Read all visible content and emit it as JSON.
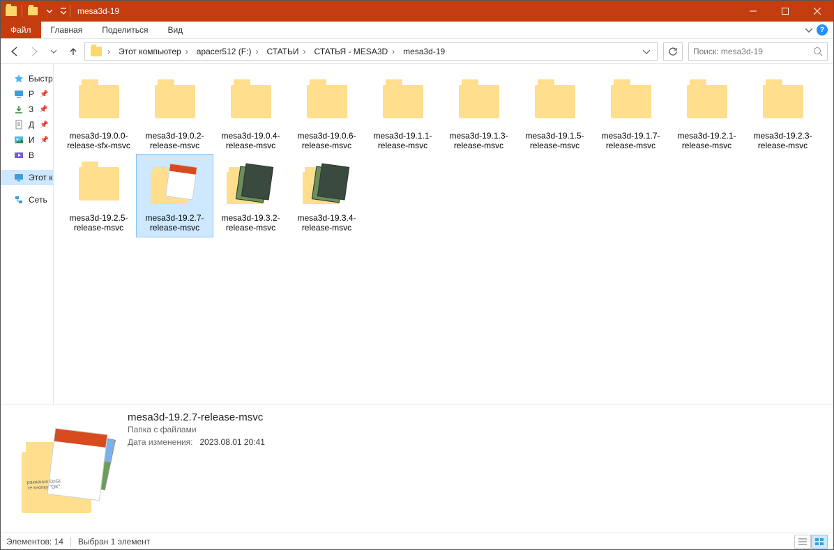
{
  "window": {
    "title": "mesa3d-19"
  },
  "tabs": {
    "file": "Файл",
    "home": "Главная",
    "share": "Поделиться",
    "view": "Вид"
  },
  "breadcrumbs": [
    "Этот компьютер",
    "apacer512 (F:)",
    "СТАТЬИ",
    "СТАТЬЯ - MESA3D",
    "mesa3d-19"
  ],
  "search": {
    "placeholder": "Поиск: mesa3d-19"
  },
  "sidebar": {
    "quick": "Быстр",
    "items": [
      {
        "label": "Р",
        "pinned": true,
        "icon": "desktop"
      },
      {
        "label": "З",
        "pinned": true,
        "icon": "downloads"
      },
      {
        "label": "Д",
        "pinned": true,
        "icon": "documents"
      },
      {
        "label": "И",
        "pinned": true,
        "icon": "pictures"
      },
      {
        "label": "В",
        "pinned": false,
        "icon": "videos"
      }
    ],
    "thispc": "Этот к",
    "network": "Сеть"
  },
  "folders": [
    {
      "name": "mesa3d-19.0.0-release-sfx-msvc",
      "preview": "plain"
    },
    {
      "name": "mesa3d-19.0.2-release-msvc",
      "preview": "plain"
    },
    {
      "name": "mesa3d-19.0.4-release-msvc",
      "preview": "plain"
    },
    {
      "name": "mesa3d-19.0.6-release-msvc",
      "preview": "plain"
    },
    {
      "name": "mesa3d-19.1.1-release-msvc",
      "preview": "plain"
    },
    {
      "name": "mesa3d-19.1.3-release-msvc",
      "preview": "plain"
    },
    {
      "name": "mesa3d-19.1.5-release-msvc",
      "preview": "plain"
    },
    {
      "name": "mesa3d-19.1.7-release-msvc",
      "preview": "plain"
    },
    {
      "name": "mesa3d-19.2.1-release-msvc",
      "preview": "plain"
    },
    {
      "name": "mesa3d-19.2.3-release-msvc",
      "preview": "plain"
    },
    {
      "name": "mesa3d-19.2.5-release-msvc",
      "preview": "plain"
    },
    {
      "name": "mesa3d-19.2.7-release-msvc",
      "preview": "red",
      "selected": true
    },
    {
      "name": "mesa3d-19.3.2-release-msvc",
      "preview": "dark"
    },
    {
      "name": "mesa3d-19.3.4-release-msvc",
      "preview": "dark"
    }
  ],
  "details": {
    "name": "mesa3d-19.2.7-release-msvc",
    "type": "Папка с файлами",
    "modified_label": "Дата изменения:",
    "modified_value": "2023.08.01 20:41"
  },
  "status": {
    "count_label": "Элементов: 14",
    "selection_label": "Выбран 1 элемент"
  }
}
